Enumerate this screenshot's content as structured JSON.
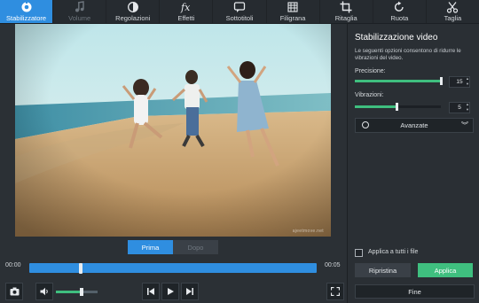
{
  "toolbar": {
    "tools": [
      {
        "label": "Stabilizzatore",
        "icon": "stabilizer-icon",
        "state": "active"
      },
      {
        "label": "Volume",
        "icon": "music-note-icon",
        "state": "disabled"
      },
      {
        "label": "Regolazioni",
        "icon": "contrast-icon",
        "state": "normal"
      },
      {
        "label": "Effetti",
        "icon": "fx-icon",
        "state": "normal"
      },
      {
        "label": "Sottotitoli",
        "icon": "subtitle-icon",
        "state": "normal"
      },
      {
        "label": "Filigrana",
        "icon": "watermark-icon",
        "state": "normal"
      },
      {
        "label": "Ritaglia",
        "icon": "crop-icon",
        "state": "normal"
      },
      {
        "label": "Ruota",
        "icon": "rotate-icon",
        "state": "normal"
      },
      {
        "label": "Taglia",
        "icon": "scissors-icon",
        "state": "normal"
      }
    ]
  },
  "preview": {
    "watermark": "ajeetmove.net",
    "before_label": "Prima",
    "after_label": "Dopo",
    "active_view": "before"
  },
  "timeline": {
    "time_start": "00:00",
    "time_end": "00:05",
    "playhead_fraction": 0.18
  },
  "player": {
    "volume_fraction": 0.62
  },
  "panel": {
    "title": "Stabilizzazione video",
    "description": "Le seguenti opzioni consentono di ridurre le vibrazioni del video.",
    "precision_label": "Precisione:",
    "precision_value": "15",
    "precision_fraction": 1.0,
    "vibrations_label": "Vibrazioni:",
    "vibrations_value": "5",
    "vibrations_fraction": 0.48,
    "advanced_label": "Avanzate",
    "apply_all_label": "Applica a tutti i file",
    "apply_all_checked": false,
    "reset_label": "Ripristina",
    "apply_label": "Applica",
    "done_label": "Fine"
  },
  "colors": {
    "accent_blue": "#2f8ee0",
    "accent_green": "#3fbf7f",
    "background": "#2b3035"
  }
}
